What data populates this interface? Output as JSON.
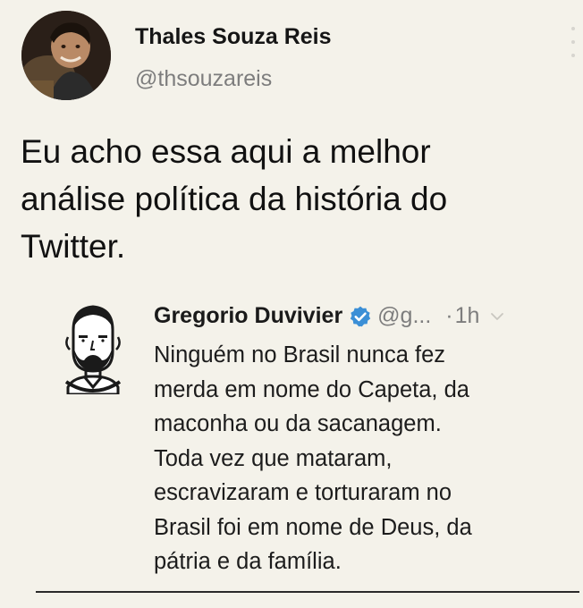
{
  "tweet": {
    "author": {
      "name": "Thales Souza Reis",
      "handle": "@thsouzareis"
    },
    "text_lines": [
      "Eu acho essa aqui a melhor",
      "análise política da história do",
      "Twitter."
    ],
    "quoted": {
      "name": "Gregorio Duvivier",
      "handle": "@g...",
      "separator": "·",
      "time": "1h",
      "text_lines": [
        "Ninguém no Brasil nunca fez",
        "merda em nome do Capeta, da",
        "maconha ou da sacanagem.",
        "Toda vez que mataram,",
        "escravizaram e torturaram no",
        "Brasil foi em nome de Deus, da",
        "pátria e da família."
      ]
    }
  },
  "colors": {
    "background": "#f4f2ea",
    "verified_badge": "#3b8fd6",
    "handle_gray": "#7d7d7d"
  },
  "icons": [
    "verified-badge-icon",
    "chevron-down-icon",
    "more-menu-icon"
  ]
}
